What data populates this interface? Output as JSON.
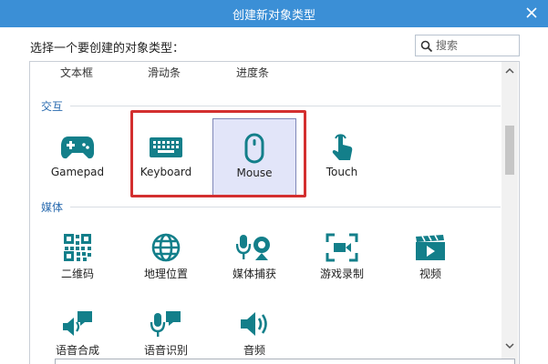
{
  "window": {
    "title": "创建新对象类型",
    "colors": {
      "titlebar": "#3b8fd6",
      "accent_icon": "#137f8a",
      "selection": "#e2e5f9",
      "highlight": "#d32f2f"
    }
  },
  "prompt": "选择一个要创建的对象类型：",
  "search": {
    "placeholder": "搜索",
    "value": ""
  },
  "top_row": [
    "文本框",
    "滑动条",
    "进度条"
  ],
  "sections": {
    "interaction": {
      "label": "交互",
      "items": [
        {
          "label": "Gamepad",
          "icon": "gamepad-icon"
        },
        {
          "label": "Keyboard",
          "icon": "keyboard-icon"
        },
        {
          "label": "Mouse",
          "icon": "mouse-icon",
          "selected": true
        },
        {
          "label": "Touch",
          "icon": "touch-icon"
        }
      ]
    },
    "media": {
      "label": "媒体",
      "items": [
        {
          "label": "二维码",
          "icon": "qr-code-icon"
        },
        {
          "label": "地理位置",
          "icon": "globe-icon"
        },
        {
          "label": "媒体捕获",
          "icon": "media-capture-icon"
        },
        {
          "label": "游戏录制",
          "icon": "game-recording-icon"
        },
        {
          "label": "视频",
          "icon": "video-icon"
        },
        {
          "label": "语音合成",
          "icon": "speech-synthesis-icon"
        },
        {
          "label": "语音识别",
          "icon": "speech-recognition-icon"
        },
        {
          "label": "音频",
          "icon": "audio-icon"
        }
      ]
    }
  }
}
